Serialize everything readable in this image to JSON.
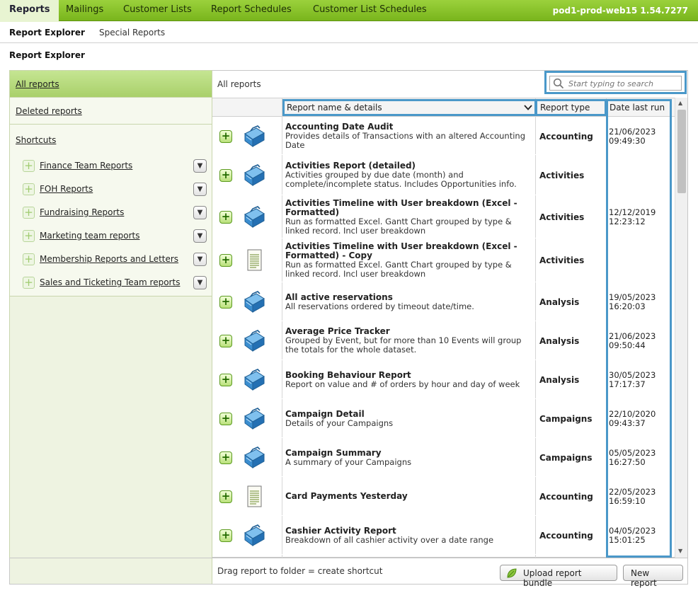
{
  "topnav": {
    "tabs": [
      {
        "label": "Reports"
      },
      {
        "label": "Mailings"
      },
      {
        "label": "Customer Lists"
      },
      {
        "label": "Report Schedules"
      },
      {
        "label": "Customer List Schedules"
      }
    ],
    "server": "pod1-prod-web15 1.54.7277"
  },
  "subnav": {
    "items": [
      {
        "label": "Report Explorer"
      },
      {
        "label": "Special Reports"
      }
    ]
  },
  "page_title": "Report Explorer",
  "sidebar": {
    "all_reports": "All reports",
    "deleted_reports": "Deleted reports",
    "shortcuts_label": "Shortcuts",
    "shortcuts": [
      {
        "label": "Finance Team Reports"
      },
      {
        "label": "FOH Reports"
      },
      {
        "label": "Fundraising Reports"
      },
      {
        "label": "Marketing team reports"
      },
      {
        "label": "Membership Reports and Letters"
      },
      {
        "label": "Sales and Ticketing Team reports"
      }
    ]
  },
  "main": {
    "breadcrumb": "All reports",
    "search": {
      "placeholder": "Start typing to search"
    },
    "columns": {
      "name": "Report name & details",
      "type": "Report type",
      "date": "Date last run"
    },
    "rows": [
      {
        "icon": "toolbox-icon",
        "title": "Accounting Date Audit",
        "desc": "Provides details of Transactions with an altered Accounting Date",
        "type": "Accounting",
        "date": "21/06/2023",
        "time": "09:49:30"
      },
      {
        "icon": "toolbox-icon",
        "title": "Activities Report (detailed)",
        "desc": "Activities grouped by due date (month) and complete/incomplete status. Includes Opportunities info.",
        "type": "Activities",
        "date": "",
        "time": ""
      },
      {
        "icon": "toolbox-icon",
        "title": "Activities Timeline with User breakdown (Excel - Formatted)",
        "desc": "Run as formatted Excel. Gantt Chart grouped by type & linked record. Incl user breakdown",
        "type": "Activities",
        "date": "12/12/2019",
        "time": "12:23:12"
      },
      {
        "icon": "document-icon",
        "title": "Activities Timeline with User breakdown (Excel - Formatted) - Copy",
        "desc": "Run as formatted Excel. Gantt Chart grouped by type & linked record. Incl user breakdown",
        "type": "Activities",
        "date": "",
        "time": ""
      },
      {
        "icon": "toolbox-icon",
        "title": "All active reservations",
        "desc": "All reservations ordered by timeout date/time.",
        "type": "Analysis",
        "date": "19/05/2023",
        "time": "16:20:03"
      },
      {
        "icon": "toolbox-icon",
        "title": "Average Price Tracker",
        "desc": "Grouped by Event, but for more than 10 Events will group the totals for the whole dataset.",
        "type": "Analysis",
        "date": "21/06/2023",
        "time": "09:50:44"
      },
      {
        "icon": "toolbox-icon",
        "title": "Booking Behaviour Report",
        "desc": "Report on value and # of orders by hour and day of week",
        "type": "Analysis",
        "date": "30/05/2023",
        "time": "17:17:37"
      },
      {
        "icon": "toolbox-icon",
        "title": "Campaign Detail",
        "desc": "Details of your Campaigns",
        "type": "Campaigns",
        "date": "22/10/2020",
        "time": "09:43:37"
      },
      {
        "icon": "toolbox-icon",
        "title": "Campaign Summary",
        "desc": "A summary of your Campaigns",
        "type": "Campaigns",
        "date": "05/05/2023",
        "time": "16:27:50"
      },
      {
        "icon": "document-icon",
        "title": "Card Payments Yesterday",
        "desc": "",
        "type": "Accounting",
        "date": "22/05/2023",
        "time": "16:59:10"
      },
      {
        "icon": "toolbox-icon",
        "title": "Cashier Activity Report",
        "desc": "Breakdown of all cashier activity over a date range",
        "type": "Accounting",
        "date": "04/05/2023",
        "time": "15:01:25"
      }
    ]
  },
  "footer": {
    "hint": "Drag report to folder = create shortcut",
    "upload_label": "Upload report bundle",
    "new_label": "New report"
  },
  "colors": {
    "accent_green": "#79b51c",
    "highlight_blue": "#4a98c9"
  }
}
